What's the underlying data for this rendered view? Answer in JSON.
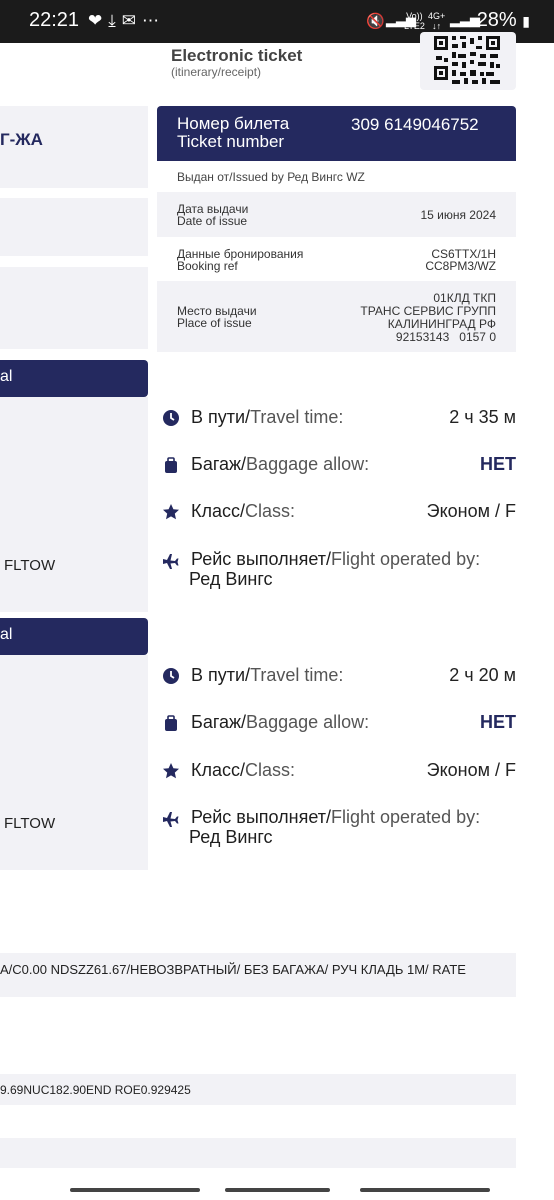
{
  "status_bar": {
    "time": "22:21",
    "net_top": "Vo))",
    "net_bottom": "LTE2",
    "net2_top": "4G+",
    "battery": "28%"
  },
  "header": {
    "title": "Electronic ticket",
    "subtitle": "(itinerary/receipt)"
  },
  "route_code": "Г-ЖА",
  "ticket": {
    "label_ru": "Номер билета",
    "label_en": "Ticket number",
    "number": "309 6149046752",
    "issued_by": "Выдан от/Issued by Ред Вингс WZ",
    "date_label_ru": "Дата выдачи",
    "date_label_en": "Date of issue",
    "date_value": "15 июня 2024",
    "booking_label_ru": "Данные бронирования",
    "booking_label_en": "Booking ref",
    "booking_value_1": "CS6TTX/1H",
    "booking_value_2": "CC8PM3/WZ",
    "place_label_ru": "Место выдачи",
    "place_label_en": "Place of issue",
    "place_value_1": "01КЛД ТКП",
    "place_value_2": "ТРАНС СЕРВИС ГРУПП",
    "place_value_3": "КАЛИНИНГРАД РФ",
    "place_value_4": "92153143   0157 0"
  },
  "segments": [
    {
      "bar_text": "al",
      "fltow": "FLTOW",
      "travel_ru": "В пути/",
      "travel_en": "Travel time:",
      "travel_value": "2 ч 35 м",
      "baggage_ru": "Багаж/",
      "baggage_en": "Baggage allow:",
      "baggage_value": "НЕТ",
      "class_ru": "Класс/",
      "class_en": "Class:",
      "class_value": "Эконом / F",
      "operated_ru": "Рейс выполняет/",
      "operated_en": "Flight operated by:",
      "operator": "Ред Вингс"
    },
    {
      "bar_text": "al",
      "fltow": "FLTOW",
      "travel_ru": "В пути/",
      "travel_en": "Travel time:",
      "travel_value": "2 ч 20 м",
      "baggage_ru": "Багаж/",
      "baggage_en": "Baggage allow:",
      "baggage_value": "НЕТ",
      "class_ru": "Класс/",
      "class_en": "Class:",
      "class_value": "Эконом / F",
      "operated_ru": "Рейс выполняет/",
      "operated_en": "Flight operated by:",
      "operator": "Ред Вингс"
    }
  ],
  "fare_line": "А/C0.00 NDSZZ61.67/НЕВОЗВРАТНЫЙ/ БЕЗ БАГАЖА/ РУЧ КЛАДЬ 1М/ RATE",
  "calc_line": "9.69NUC182.90END ROE0.929425",
  "colors": {
    "navy": "#24295f",
    "panel": "#f2f2f6"
  }
}
